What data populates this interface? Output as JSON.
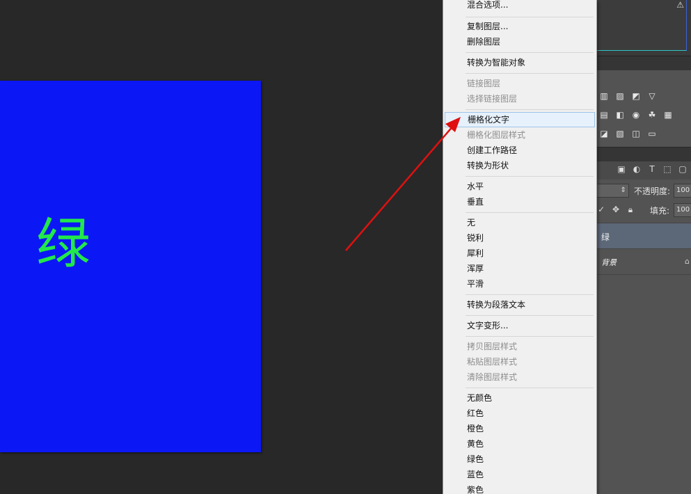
{
  "canvas": {
    "text": "绿",
    "background_color": "#0c17f5",
    "text_color": "#22e84a"
  },
  "context_menu": {
    "items": [
      {
        "label": "混合选项...",
        "enabled": true
      },
      {
        "label": "复制图层...",
        "enabled": true
      },
      {
        "label": "删除图层",
        "enabled": true
      },
      {
        "label": "转换为智能对象",
        "enabled": true
      },
      {
        "label": "链接图层",
        "enabled": false
      },
      {
        "label": "选择链接图层",
        "enabled": false
      },
      {
        "label": "栅格化文字",
        "enabled": true,
        "highlighted": true
      },
      {
        "label": "栅格化图层样式",
        "enabled": false
      },
      {
        "label": "创建工作路径",
        "enabled": true
      },
      {
        "label": "转换为形状",
        "enabled": true
      },
      {
        "label": "水平",
        "enabled": true
      },
      {
        "label": "垂直",
        "enabled": true
      },
      {
        "label": "无",
        "enabled": true
      },
      {
        "label": "锐利",
        "enabled": true
      },
      {
        "label": "犀利",
        "enabled": true
      },
      {
        "label": "浑厚",
        "enabled": true
      },
      {
        "label": "平滑",
        "enabled": true
      },
      {
        "label": "转换为段落文本",
        "enabled": true
      },
      {
        "label": "文字变形...",
        "enabled": true
      },
      {
        "label": "拷贝图层样式",
        "enabled": false
      },
      {
        "label": "粘贴图层样式",
        "enabled": false
      },
      {
        "label": "清除图层样式",
        "enabled": false
      },
      {
        "label": "无颜色",
        "enabled": true
      },
      {
        "label": "红色",
        "enabled": true
      },
      {
        "label": "橙色",
        "enabled": true
      },
      {
        "label": "黄色",
        "enabled": true
      },
      {
        "label": "绿色",
        "enabled": true
      },
      {
        "label": "蓝色",
        "enabled": true
      },
      {
        "label": "紫色",
        "enabled": true
      }
    ]
  },
  "layers_panel": {
    "opacity_label": "不透明度:",
    "opacity_value": "100",
    "fill_label": "填充:",
    "fill_value": "100",
    "layers": [
      {
        "name": "绿",
        "selected": true
      },
      {
        "name": "背景",
        "selected": false,
        "locked": true
      }
    ]
  },
  "histogram": {
    "warning_icon": "warning-icon"
  },
  "annotation": {
    "arrow_color": "#e01010"
  }
}
